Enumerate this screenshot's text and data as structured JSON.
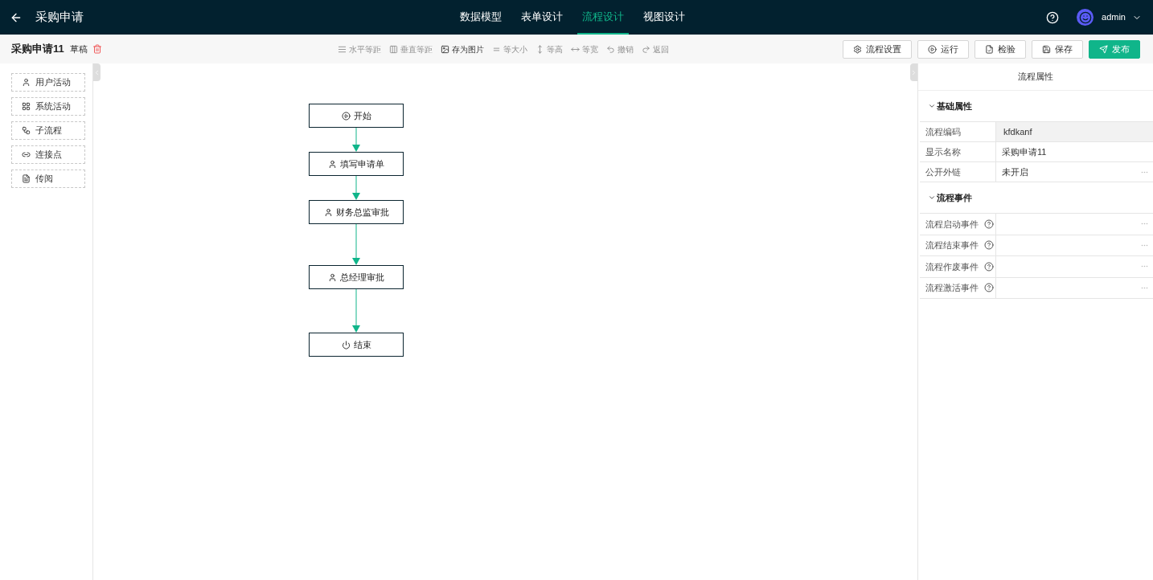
{
  "header": {
    "title": "采购申请",
    "tabs": [
      {
        "label": "数据模型",
        "selected": false
      },
      {
        "label": "表单设计",
        "selected": false
      },
      {
        "label": "流程设计",
        "selected": true
      },
      {
        "label": "视图设计",
        "selected": false
      }
    ],
    "user": "admin"
  },
  "subheader": {
    "name": "采购申请11",
    "status": "草稿"
  },
  "toolbar": [
    {
      "label": "水平等距",
      "kind": "hspace",
      "disabled": true
    },
    {
      "label": "垂直等距",
      "kind": "vspace",
      "disabled": true
    },
    {
      "label": "存为图片",
      "kind": "image",
      "disabled": false
    },
    {
      "label": "等大小",
      "kind": "size",
      "disabled": true
    },
    {
      "label": "等高",
      "kind": "height",
      "disabled": true
    },
    {
      "label": "等宽",
      "kind": "width",
      "disabled": true
    },
    {
      "label": "撤销",
      "kind": "undo",
      "disabled": true
    },
    {
      "label": "返回",
      "kind": "redo",
      "disabled": true
    }
  ],
  "actions": [
    {
      "label": "流程设置",
      "kind": "settings",
      "primary": false
    },
    {
      "label": "运行",
      "kind": "run",
      "primary": false
    },
    {
      "label": "检验",
      "kind": "check",
      "primary": false
    },
    {
      "label": "保存",
      "kind": "save",
      "primary": false
    },
    {
      "label": "发布",
      "kind": "publish",
      "primary": true
    }
  ],
  "palette": [
    {
      "label": "用户活动",
      "kind": "user"
    },
    {
      "label": "系统活动",
      "kind": "system"
    },
    {
      "label": "子流程",
      "kind": "sub"
    },
    {
      "label": "连接点",
      "kind": "link"
    },
    {
      "label": "传阅",
      "kind": "circulate"
    }
  ],
  "nodes": [
    {
      "label": "开始",
      "kind": "start"
    },
    {
      "label": "填写申请单",
      "kind": "user"
    },
    {
      "label": "财务总监审批",
      "kind": "user"
    },
    {
      "label": "总经理审批",
      "kind": "user"
    },
    {
      "label": "结束",
      "kind": "end"
    }
  ],
  "properties": {
    "title": "流程属性",
    "sections": [
      {
        "title": "基础属性",
        "expanded": true,
        "rows": [
          {
            "label": "流程编码",
            "value": "kfdkanf",
            "readonly": true,
            "more": false,
            "help": false
          },
          {
            "label": "显示名称",
            "value": "采购申请11",
            "readonly": false,
            "more": false,
            "help": false
          },
          {
            "label": "公开外链",
            "value": "未开启",
            "readonly": false,
            "more": true,
            "help": false
          }
        ]
      },
      {
        "title": "流程事件",
        "expanded": true,
        "rows": [
          {
            "label": "流程启动事件",
            "readonly": false,
            "more": true,
            "help": true
          },
          {
            "label": "流程结束事件",
            "readonly": false,
            "more": true,
            "help": true
          },
          {
            "label": "流程作废事件",
            "readonly": false,
            "more": true,
            "help": true
          },
          {
            "label": "流程激活事件",
            "readonly": false,
            "more": true,
            "help": true
          }
        ]
      }
    ]
  }
}
